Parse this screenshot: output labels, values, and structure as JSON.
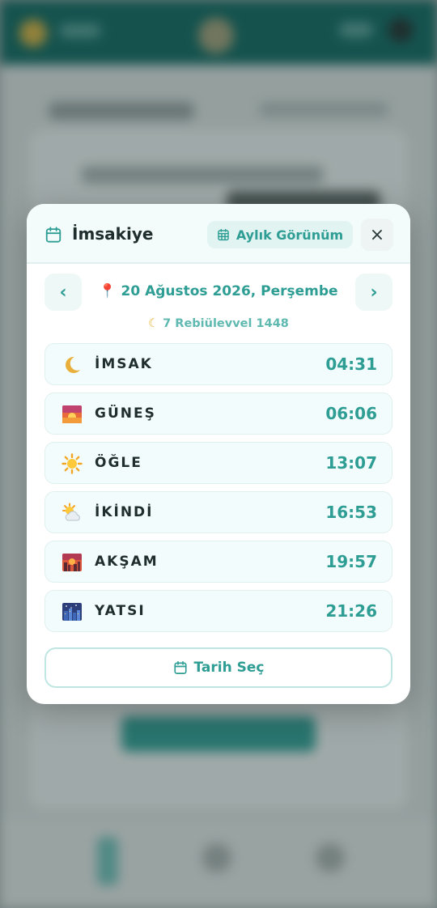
{
  "modal": {
    "title": "İmsakiye",
    "monthly_view_label": "Aylık Görünüm",
    "close_glyph": "×",
    "date_label": "20 Ağustos 2026, Perşembe",
    "hijri_label": "7 Rebiülevvel 1448",
    "prev_glyph": "‹",
    "next_glyph": "›",
    "pick_date_label": "Tarih Seç"
  },
  "prayers": [
    {
      "name": "İMSAK",
      "time": "04:31",
      "icon": "crescent-moon-icon"
    },
    {
      "name": "GÜNEŞ",
      "time": "06:06",
      "icon": "sunrise-icon"
    },
    {
      "name": "ÖĞLE",
      "time": "13:07",
      "icon": "sun-icon"
    },
    {
      "name": "İKİNDİ",
      "time": "16:53",
      "icon": "sun-behind-cloud-icon"
    },
    {
      "name": "AKŞAM",
      "time": "19:57",
      "icon": "sunset-city-icon"
    },
    {
      "name": "YATSI",
      "time": "21:26",
      "icon": "night-city-icon"
    }
  ],
  "colors": {
    "accent": "#2e9d94",
    "header_bg": "#0f5d57",
    "title_text": "#1f2d2d",
    "pin": "#e53935"
  }
}
